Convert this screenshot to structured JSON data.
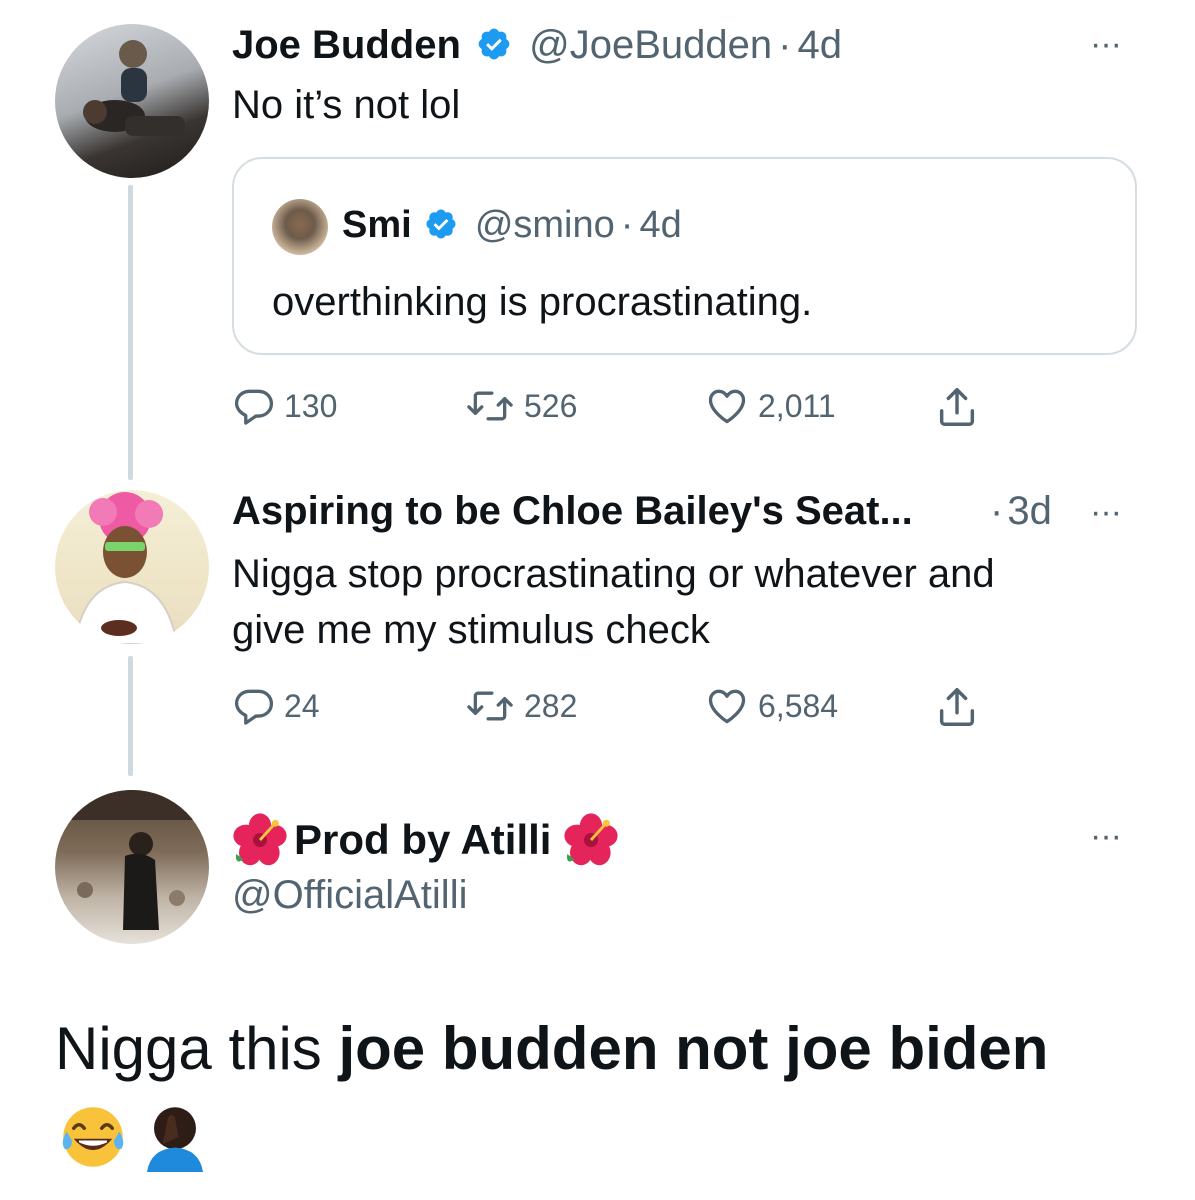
{
  "colors": {
    "text": "#0f1419",
    "muted": "#536471",
    "verified": "#1d9bf0",
    "thread_line": "#cfd9de",
    "card_border": "#d5dde2"
  },
  "tweet1": {
    "name": "Joe Budden",
    "handle": "@JoeBudden",
    "time": "4d",
    "text": "No it’s not lol",
    "quote": {
      "name": "Smi",
      "handle": "@smino",
      "time": "4d",
      "text": "overthinking is procrastinating."
    },
    "replies": "130",
    "retweets": "526",
    "likes": "2,011"
  },
  "tweet2": {
    "name": "Aspiring to be Chloe Bailey's Seat...",
    "time": "3d",
    "text_line1": "Nigga stop procrastinating or whatever and",
    "text_line2": "give me my stimulus check",
    "replies": "24",
    "retweets": "282",
    "likes": "6,584"
  },
  "tweet3": {
    "name": "Prod by Atilli",
    "handle": "@OfficialAtilli",
    "text_normal": "Nigga this",
    "text_bold": "joe budden not joe biden",
    "icons": [
      "hibiscus-emoji",
      "tears-of-joy-emoji",
      "facepalm-emoji"
    ]
  },
  "separator_dot": "·",
  "more_glyph": "···"
}
